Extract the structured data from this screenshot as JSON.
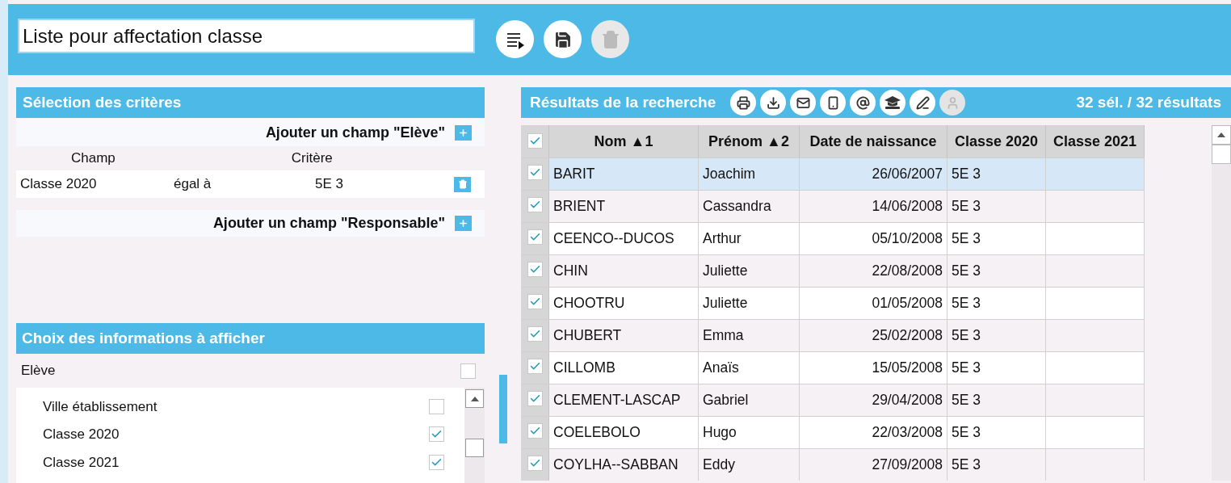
{
  "title_field": {
    "value": "Liste pour affectation classe"
  },
  "top_actions": [
    {
      "kind": "run",
      "disabled": false
    },
    {
      "kind": "save",
      "disabled": false
    },
    {
      "kind": "delete",
      "disabled": true
    }
  ],
  "criteria_panel": {
    "title": "Sélection des critères",
    "add_student": "Ajouter un champ \"Elève\"",
    "columns": [
      "Champ",
      "Critère"
    ],
    "criteria": [
      {
        "field": "Classe 2020",
        "operator": "égal à",
        "value": "5E 3"
      }
    ],
    "add_guardian": "Ajouter un champ \"Responsable\""
  },
  "display_panel": {
    "title": "Choix des informations à afficher",
    "group": {
      "label": "Elève",
      "checked": false
    },
    "items": [
      {
        "label": "Ville établissement",
        "checked": false
      },
      {
        "label": "Classe 2020",
        "checked": true
      },
      {
        "label": "Classe 2021",
        "checked": true
      }
    ]
  },
  "results": {
    "title": "Résultats de la recherche",
    "actions": [
      {
        "kind": "print",
        "disabled": false
      },
      {
        "kind": "download",
        "disabled": false
      },
      {
        "kind": "mail",
        "disabled": false
      },
      {
        "kind": "phone",
        "disabled": false
      },
      {
        "kind": "at",
        "disabled": false
      },
      {
        "kind": "hat",
        "disabled": false
      },
      {
        "kind": "sign",
        "disabled": false
      },
      {
        "kind": "person",
        "disabled": true
      }
    ],
    "count": "32 sél. / 32 résultats",
    "table": {
      "all_checked": true,
      "columns": [
        "Nom ▲1",
        "Prénom ▲2",
        "Date de naissance",
        "Classe 2020",
        "Classe 2021"
      ],
      "rows": [
        {
          "checked": true,
          "selected": true,
          "cells": [
            "BARIT",
            "Joachim",
            "26/06/2007",
            "5E 3"
          ]
        },
        {
          "checked": true,
          "selected": false,
          "cells": [
            "BRIENT",
            "Cassandra",
            "14/06/2008",
            "5E 3"
          ]
        },
        {
          "checked": true,
          "selected": false,
          "cells": [
            "CEENCO--DUCOS",
            "Arthur",
            "05/10/2008",
            "5E 3"
          ]
        },
        {
          "checked": true,
          "selected": false,
          "cells": [
            "CHIN",
            "Juliette",
            "22/08/2008",
            "5E 3"
          ]
        },
        {
          "checked": true,
          "selected": false,
          "cells": [
            "CHOOTRU",
            "Juliette",
            "01/05/2008",
            "5E 3"
          ]
        },
        {
          "checked": true,
          "selected": false,
          "cells": [
            "CHUBERT",
            "Emma",
            "25/02/2008",
            "5E 3"
          ]
        },
        {
          "checked": true,
          "selected": false,
          "cells": [
            "CILLOMB",
            "Anaïs",
            "15/05/2008",
            "5E 3"
          ]
        },
        {
          "checked": true,
          "selected": false,
          "cells": [
            "CLEMENT-LASCAP",
            "Gabriel",
            "29/04/2008",
            "5E 3"
          ]
        },
        {
          "checked": true,
          "selected": false,
          "cells": [
            "COELEBOLO",
            "Hugo",
            "22/03/2008",
            "5E 3"
          ]
        },
        {
          "checked": true,
          "selected": false,
          "cells": [
            "COYLHA--SABBAN",
            "Eddy",
            "27/09/2008",
            "5E 3"
          ]
        }
      ]
    }
  }
}
